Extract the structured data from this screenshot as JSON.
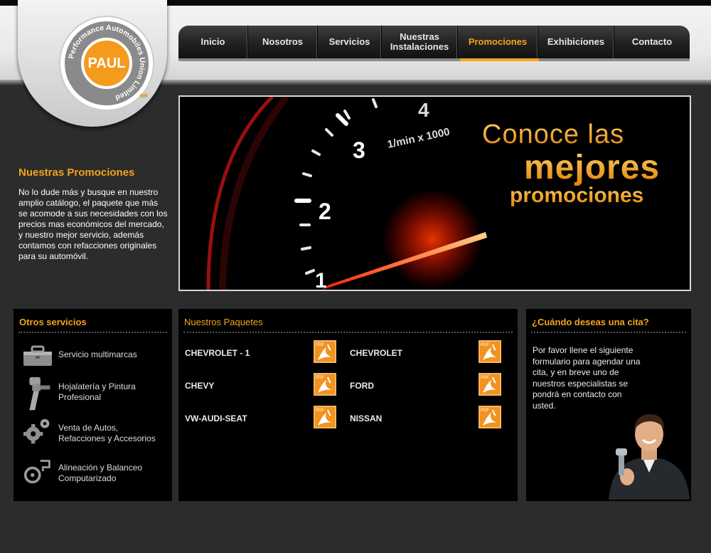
{
  "logo": {
    "name": "PAUL",
    "ring_text": "Performance Automobiles Union Limited",
    "reg": "MR"
  },
  "nav": {
    "items": [
      {
        "label": "Inicio",
        "active": false
      },
      {
        "label": "Nosotros",
        "active": false
      },
      {
        "label": "Servicios",
        "active": false
      },
      {
        "label": "Nuestras\nInstalaciones",
        "active": false
      },
      {
        "label": "Promociones",
        "active": true
      },
      {
        "label": "Exhibiciones",
        "active": false
      },
      {
        "label": "Contacto",
        "active": false
      }
    ]
  },
  "promo": {
    "title": "Nuestras Promociones",
    "body": "No lo dude más y busque en nuestro amplio catálogo, el paquete que más se acomode a sus necesidades con los precios mas económicos del mercado, y nuestro mejor servicio, además contamos con refacciones originales para su automóvil."
  },
  "banner": {
    "line1": "Conoce las",
    "line2": "mejores",
    "line3": "promociones",
    "gauge_unit": "1/min x 1000",
    "gauge_numbers": [
      "1",
      "2",
      "3",
      "4"
    ]
  },
  "otros_servicios": {
    "title": "Otros servicios",
    "items": [
      {
        "label": "Servicio multimarcas",
        "icon": "toolbox-icon"
      },
      {
        "label": "Hojalatería y Pintura\nProfesional",
        "icon": "spray-gun-icon"
      },
      {
        "label": "Venta de Autos,\nRefacciones y Accesorios",
        "icon": "gears-icon"
      },
      {
        "label": "Alineación y Balanceo\nComputarizado",
        "icon": "wheel-alignment-icon"
      }
    ]
  },
  "paquetes": {
    "title": "Nuestros Paquetes",
    "pdf_badge": "PDF",
    "items": [
      {
        "label": "CHEVROLET - 1"
      },
      {
        "label": "CHEVROLET"
      },
      {
        "label": "CHEVY"
      },
      {
        "label": "FORD"
      },
      {
        "label": "VW-AUDI-SEAT"
      },
      {
        "label": "NISSAN"
      }
    ]
  },
  "cita": {
    "title": "¿Cuándo deseas una cita?",
    "body": "Por favor llene el siguiente formulario para agendar una cita, y en breve uno de nuestros especialistas se pondrá en contacto con usted."
  },
  "colors": {
    "accent": "#f5a31a",
    "background": "#2c2c2c",
    "panel": "#000000"
  }
}
